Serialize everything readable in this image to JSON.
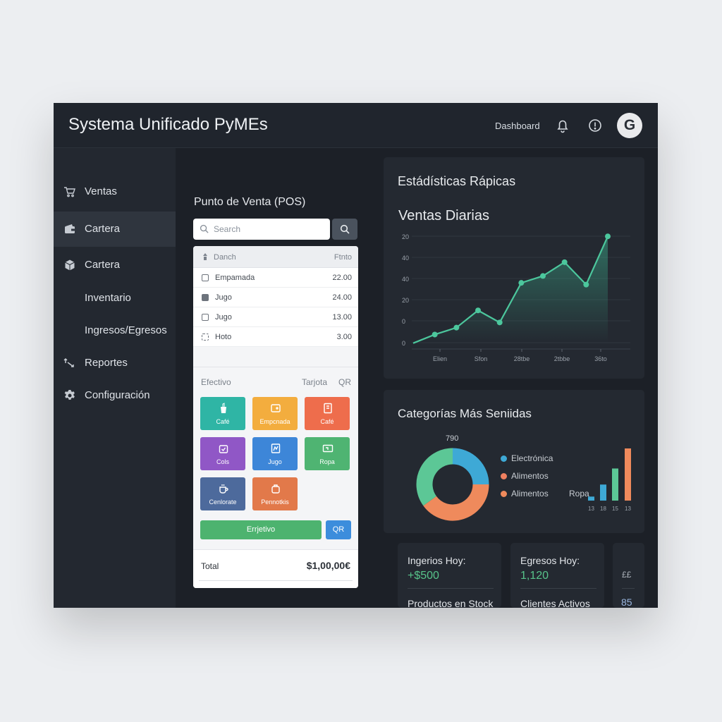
{
  "header": {
    "title": "Systema Unificado PyMEs",
    "nav_dashboard": "Dashboard",
    "avatar_initial": "G"
  },
  "sidebar": {
    "items": [
      {
        "label": "Ventas",
        "icon": "cart-icon"
      },
      {
        "label": "Cartera",
        "icon": "wallet-icon",
        "active": true
      },
      {
        "label": "Cartera",
        "icon": "box-icon"
      },
      {
        "label": "Inventario",
        "icon": ""
      },
      {
        "label": "Ingresos/Egresos",
        "icon": ""
      },
      {
        "label": "Reportes",
        "icon": "arrows-icon"
      },
      {
        "label": "Configuración",
        "icon": "gear-icon"
      }
    ]
  },
  "pos": {
    "title": "Punto de Venta (POS)",
    "search_placeholder": "Search",
    "table_header": {
      "name": "Danch",
      "price": "Ftnto"
    },
    "rows": [
      {
        "name": "Empamada",
        "price": "22.00"
      },
      {
        "name": "Jugo",
        "price": "24.00"
      },
      {
        "name": "Jugo",
        "price": "13.00"
      },
      {
        "name": "Hoto",
        "price": "3.00"
      }
    ],
    "payment_methods": [
      "Efectivo",
      "Tarjota",
      "QR"
    ],
    "tiles": [
      {
        "label": "Café",
        "color": "#2fb5a5",
        "icon": "cup-icon"
      },
      {
        "label": "Empcnada",
        "color": "#f3ad3e",
        "icon": "wallet-icon"
      },
      {
        "label": "Café",
        "color": "#ee6d4c",
        "icon": "receipt-icon"
      },
      {
        "label": "Cols",
        "color": "#9057c6",
        "icon": "bag-icon"
      },
      {
        "label": "Jugo",
        "color": "#3d86d8",
        "icon": "card-icon"
      },
      {
        "label": "Ropa",
        "color": "#4fb472",
        "icon": "cash-icon"
      },
      {
        "label": "Cenlorate",
        "color": "#4d6a9c",
        "icon": "coffee-icon"
      },
      {
        "label": "Pennotkis",
        "color": "#e2794a",
        "icon": "pot-icon"
      }
    ],
    "btn_cash": "Errjetivo",
    "btn_qr": "QR",
    "total_label": "Total",
    "total_value": "$1,00,00€"
  },
  "stats": {
    "title": "Estádísticas Rápicas",
    "chart_title": "Ventas Diarias",
    "donut_title": "Categorías Más Seniidas",
    "donut_top_label": "790",
    "legend": [
      {
        "label": "Electrónica",
        "color": "#3ea9d6"
      },
      {
        "label": "Alimentos",
        "color": "#ef8060"
      },
      {
        "label": "Alimentos",
        "color": "#ef8a5c"
      }
    ],
    "bars_label": "Ropa"
  },
  "kpis": {
    "ingresos_label": "Ingerios Hoy:",
    "ingresos_value": "+$500",
    "egresos_label": "Egresos Hoy:",
    "egresos_value": "1,120",
    "stock_label": "Productos en Stock",
    "clientes_label": "Clientes Activos",
    "third_top": "££",
    "third_value": "85"
  },
  "chart_data": [
    {
      "type": "area",
      "title": "Ventas Diarias",
      "y_ticks": [
        "20",
        "40",
        "40",
        "20",
        "0",
        "0"
      ],
      "x_ticks": [
        "Elien",
        "Sfon",
        "28tbe",
        "2tbbe",
        "36to"
      ],
      "values": [
        3,
        8,
        12,
        22,
        15,
        38,
        42,
        50,
        37,
        65
      ],
      "ylim": [
        0,
        70
      ]
    },
    {
      "type": "pie",
      "title": "Categorías Más Seniidas",
      "slices": [
        {
          "label": "Electrónica",
          "value": 25,
          "color": "#3ea9d6"
        },
        {
          "label": "Alimentos",
          "value": 40,
          "color": "#ef8a5c"
        },
        {
          "label": "",
          "value": 35,
          "color": "#5cc796"
        }
      ]
    },
    {
      "type": "bar",
      "categories": [
        "13",
        "18",
        "15",
        "13"
      ],
      "values": [
        1,
        4,
        8,
        13
      ],
      "colors": [
        "#3ea9d6",
        "#3ea9d6",
        "#5cc796",
        "#ef8a5c"
      ]
    }
  ]
}
